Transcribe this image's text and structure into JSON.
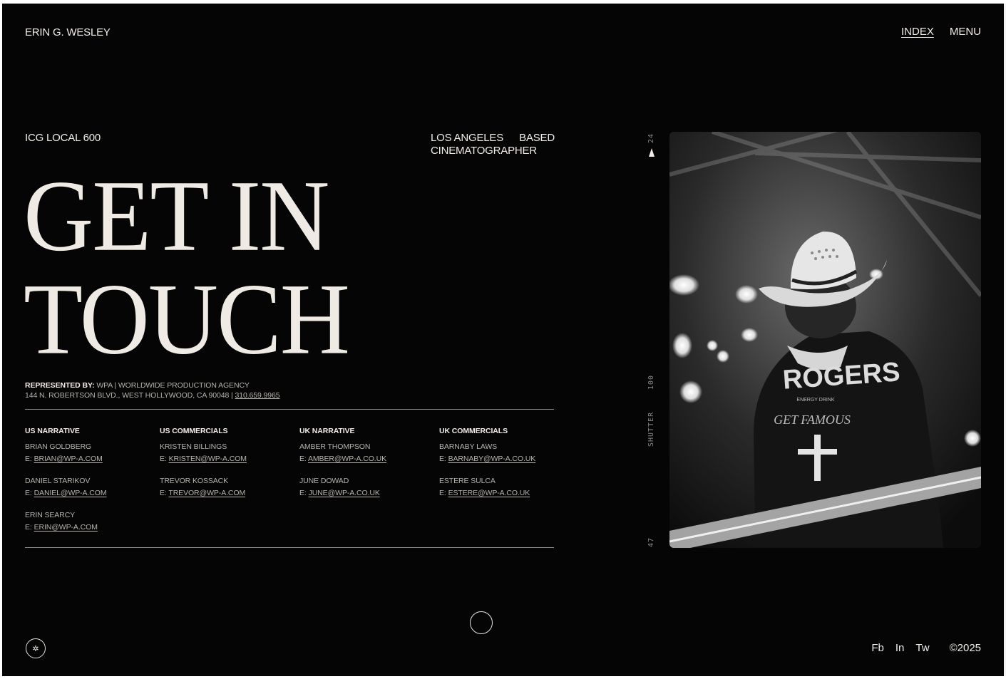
{
  "header": {
    "brand": "ERIN G. WESLEY",
    "nav": [
      {
        "label": "INDEX"
      },
      {
        "label": "MENU"
      }
    ]
  },
  "intro": {
    "union": "ICG LOCAL 600",
    "based_line1_a": "LOS ANGELES",
    "based_line1_b": "BASED",
    "based_line2": "CINEMATOGRAPHER"
  },
  "headline": {
    "line1": "GET IN",
    "line2": "TOUCH"
  },
  "representation": {
    "label": "REPRESENTED BY:",
    "agency": "WPA | WORLDWIDE PRODUCTION AGENCY",
    "address": "144 N. ROBERTSON BLVD., WEST HOLLYWOOD, CA 90048 |",
    "phone": "310.659.9965"
  },
  "agents": {
    "columns": [
      {
        "title": "US NARRATIVE",
        "people": [
          {
            "name": "BRIAN GOLDBERG",
            "prefix": "E:",
            "email": "BRIAN@WP-A.COM"
          },
          {
            "name": "DANIEL STARIKOV",
            "prefix": "E:",
            "email": "DANIEL@WP-A.COM"
          },
          {
            "name": "ERIN SEARCY",
            "prefix": "E:",
            "email": "ERIN@WP-A.COM"
          }
        ]
      },
      {
        "title": "US COMMERCIALS",
        "people": [
          {
            "name": "KRISTEN BILLINGS",
            "prefix": "E:",
            "email": "KRISTEN@WP-A.COM"
          },
          {
            "name": "TREVOR KOSSACK",
            "prefix": "E:",
            "email": "TREVOR@WP-A.COM"
          }
        ]
      },
      {
        "title": "UK NARRATIVE",
        "people": [
          {
            "name": "AMBER THOMPSON",
            "prefix": "E:",
            "email": "AMBER@WP-A.CO.UK"
          },
          {
            "name": "JUNE DOWAD",
            "prefix": "E:",
            "email": "JUNE@WP-A.CO.UK"
          }
        ]
      },
      {
        "title": "UK COMMERCIALS",
        "people": [
          {
            "name": "BARNABY LAWS",
            "prefix": "E:",
            "email": "BARNABY@WP-A.CO.UK"
          },
          {
            "name": "ESTERE SULCA",
            "prefix": "E:",
            "email": "ESTERE@WP-A.CO.UK"
          }
        ]
      }
    ]
  },
  "film_strip": {
    "frame_top": "24",
    "shutter_label": "SHUTTER",
    "shutter_value": "100",
    "frame_bottom": "47"
  },
  "photo": {
    "jacket_text": "ROGERS",
    "jacket_sub1": "ENERGY DRINK",
    "jacket_sub2": "GET FAMOUS"
  },
  "footer": {
    "social": [
      {
        "label": "Fb"
      },
      {
        "label": "In"
      },
      {
        "label": "Tw"
      }
    ],
    "copyright": "©2025"
  },
  "colors": {
    "background": "#050505",
    "text": "#f1ede6",
    "muted": "#b7b3ad"
  }
}
